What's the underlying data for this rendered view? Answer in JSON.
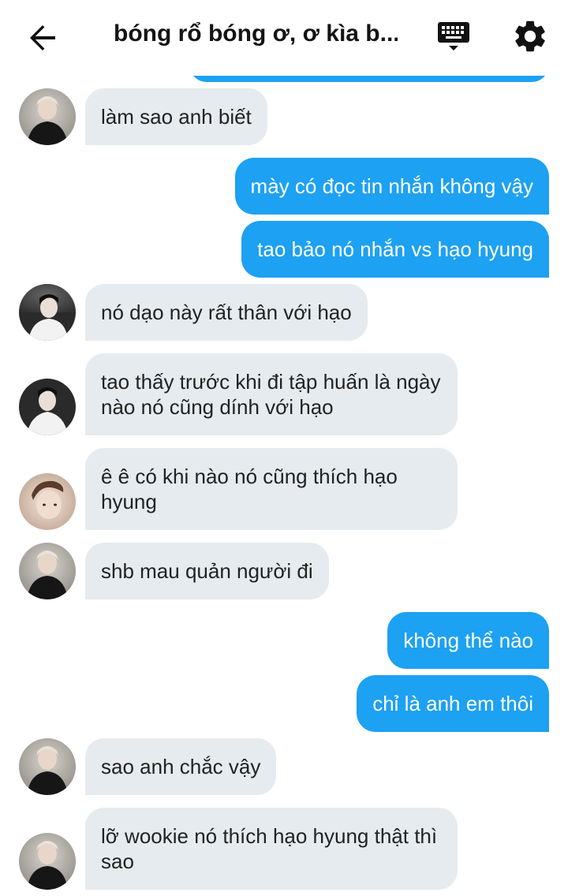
{
  "header": {
    "title": "bóng rổ bóng ơ, ơ kìa b...",
    "back_icon": "arrow-left-icon",
    "keyboard_icon": "keyboard-icon",
    "settings_icon": "gear-icon"
  },
  "colors": {
    "outgoing_bubble": "#1da1f2",
    "incoming_bubble": "#e6ebef",
    "text_dark": "#222222"
  },
  "messages": [
    {
      "direction": "in",
      "avatar": "avatar-blonde",
      "text": "làm sao anh biết"
    },
    {
      "direction": "out",
      "text": "mày có đọc tin nhắn không vậy"
    },
    {
      "direction": "out",
      "text": "tao bảo nó nhắn vs hạo hyung"
    },
    {
      "direction": "in",
      "avatar": "avatar-dark-hair",
      "text": "nó dạo này rất thân với hạo"
    },
    {
      "direction": "in",
      "avatar": "avatar-dark-hair",
      "text": "tao thấy trước khi đi tập huấn là ngày nào nó cũng dính với hạo"
    },
    {
      "direction": "in",
      "avatar": "avatar-brown-hair",
      "text": "ê ê có khi nào nó cũng thích hạo hyung"
    },
    {
      "direction": "in",
      "avatar": "avatar-blonde",
      "text": "shb mau quản người đi"
    },
    {
      "direction": "out",
      "text": "không thể nào"
    },
    {
      "direction": "out",
      "text": "chỉ là anh em thôi"
    },
    {
      "direction": "in",
      "avatar": "avatar-blonde",
      "text": "sao anh chắc vậy"
    },
    {
      "direction": "in",
      "avatar": "avatar-blonde",
      "text": "lỡ wookie nó thích hạo hyung thật thì sao"
    }
  ]
}
